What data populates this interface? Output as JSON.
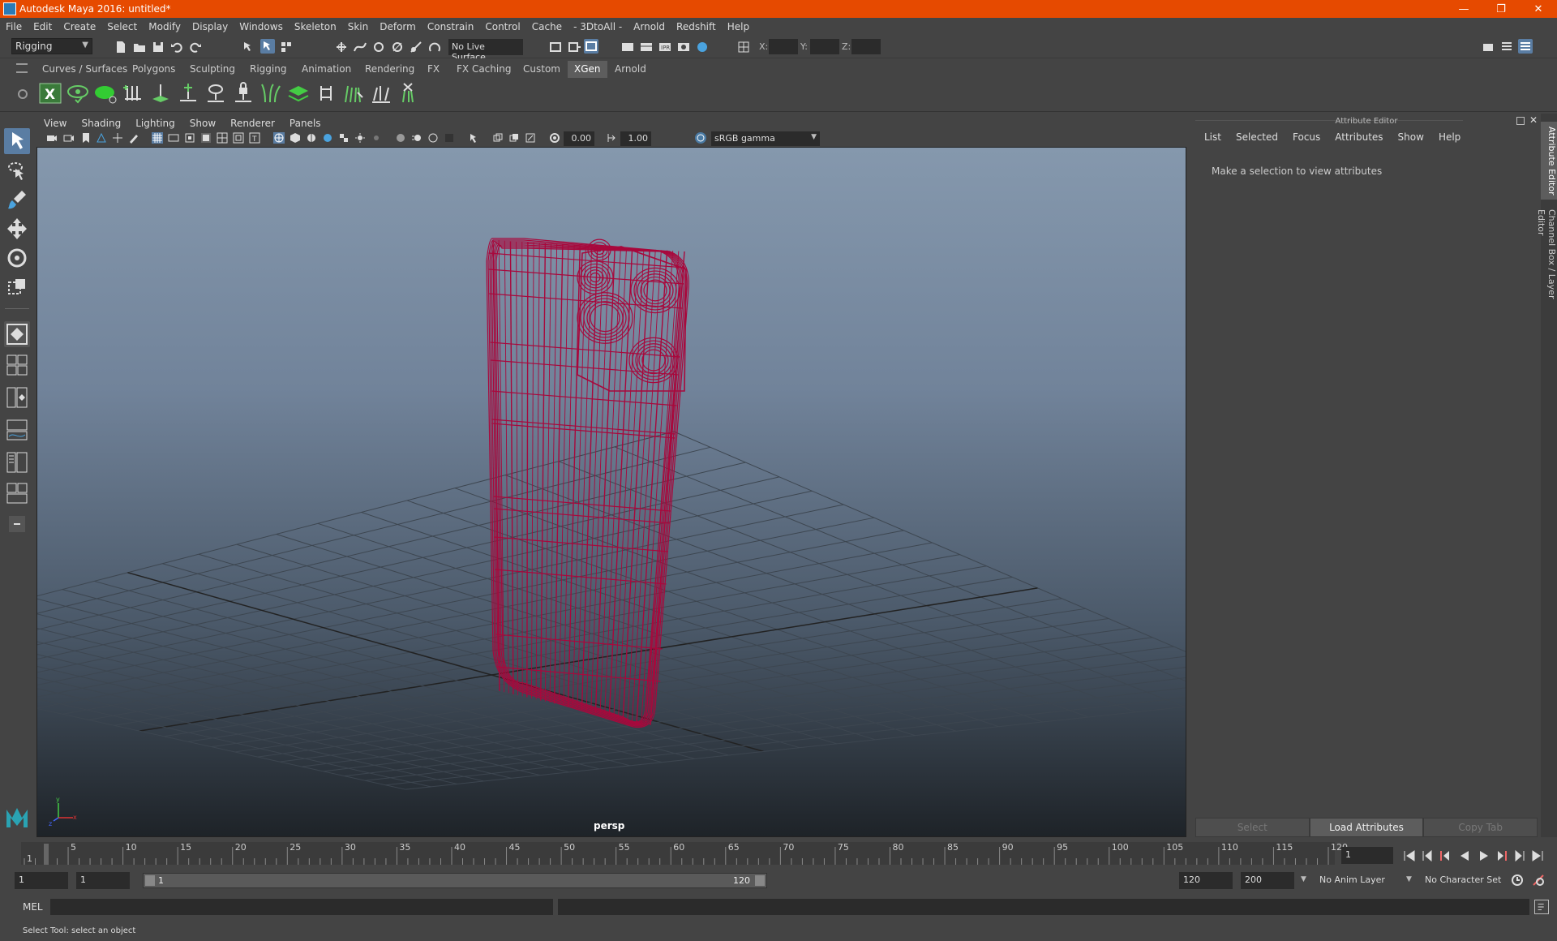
{
  "window": {
    "title": "Autodesk Maya 2016: untitled*",
    "minimize": "—",
    "restore": "❐",
    "close": "✕"
  },
  "menubar": [
    "File",
    "Edit",
    "Create",
    "Select",
    "Modify",
    "Display",
    "Windows",
    "Skeleton",
    "Skin",
    "Deform",
    "Constrain",
    "Control",
    "Cache",
    "- 3DtoAll -",
    "Arnold",
    "Redshift",
    "Help"
  ],
  "statusline": {
    "mode": "Rigging",
    "live_surface": "No Live Surface",
    "x_label": "X:",
    "y_label": "Y:",
    "z_label": "Z:"
  },
  "shelf": {
    "tabs": [
      "Curves / Surfaces",
      "Polygons",
      "Sculpting",
      "Rigging",
      "Animation",
      "Rendering",
      "FX",
      "FX Caching",
      "Custom",
      "XGen",
      "Arnold"
    ],
    "active_tab": "XGen"
  },
  "viewport": {
    "menu": [
      "View",
      "Shading",
      "Lighting",
      "Show",
      "Renderer",
      "Panels"
    ],
    "exposure": "0.00",
    "gamma": "1.00",
    "color_space": "sRGB gamma",
    "camera_label": "persp",
    "wire_color": "#a8083c"
  },
  "attribute_editor": {
    "title": "Attribute Editor",
    "menu": [
      "List",
      "Selected",
      "Focus",
      "Attributes",
      "Show",
      "Help"
    ],
    "message": "Make a selection to view attributes",
    "buttons": [
      "Select",
      "Load Attributes",
      "Copy Tab"
    ],
    "side_tabs": [
      "Attribute Editor",
      "Channel Box / Layer Editor"
    ]
  },
  "timeline": {
    "ticks": [
      "1",
      "5",
      "10",
      "15",
      "20",
      "25",
      "30",
      "35",
      "40",
      "45",
      "50",
      "55",
      "60",
      "65",
      "70",
      "75",
      "80",
      "85",
      "90",
      "95",
      "100",
      "105",
      "110",
      "115",
      "120"
    ],
    "current_frame": "1"
  },
  "range": {
    "start_frame": "1",
    "playback_start": "1",
    "slider_start": "1",
    "slider_end": "120",
    "playback_end": "120",
    "end_frame": "200",
    "anim_layer": "No Anim Layer",
    "character_set": "No Character Set"
  },
  "mel": {
    "label": "MEL"
  },
  "help_line": "Select Tool: select an object"
}
